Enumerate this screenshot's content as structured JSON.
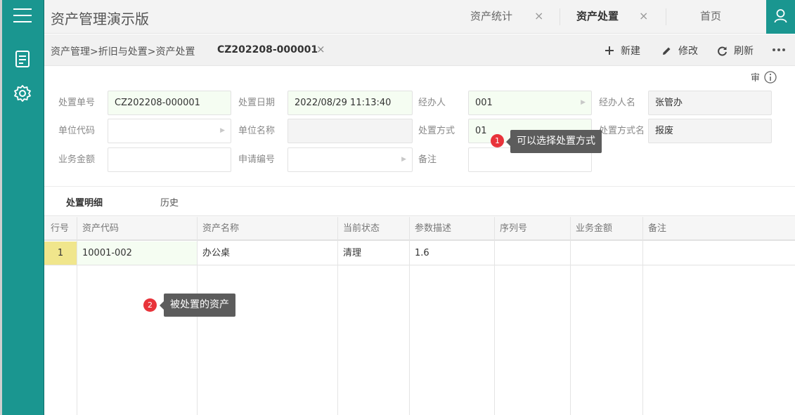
{
  "app": {
    "title": "资产管理演示版"
  },
  "tabs": [
    {
      "label": "资产统计",
      "close": "×"
    },
    {
      "label": "资产处置",
      "close": "×"
    },
    {
      "label": "首页"
    }
  ],
  "breadcrumb": {
    "path": "资产管理>折旧与处置>资产处置",
    "doc_id": "CZ202208-000001",
    "close": "×"
  },
  "toolbar": {
    "new_label": "新建",
    "edit_label": "修改",
    "refresh_label": "刷新"
  },
  "audit": {
    "label": "审"
  },
  "form": {
    "doc_no": {
      "label": "处置单号",
      "value": "CZ202208-000001"
    },
    "date": {
      "label": "处置日期",
      "value": "2022/08/29 11:13:40"
    },
    "handler": {
      "label": "经办人",
      "value": "001"
    },
    "handler_name": {
      "label": "经办人名",
      "value": "张管办"
    },
    "unit_code": {
      "label": "单位代码",
      "value": ""
    },
    "unit_name": {
      "label": "单位名称",
      "value": ""
    },
    "method": {
      "label": "处置方式",
      "value": "01"
    },
    "method_name": {
      "label": "处置方式名",
      "value": "报废"
    },
    "amount": {
      "label": "业务金额",
      "value": ""
    },
    "apply_no": {
      "label": "申请编号",
      "value": ""
    },
    "remark": {
      "label": "备注",
      "value": ""
    }
  },
  "tooltips": [
    {
      "num": "1",
      "text": "可以选择处置方式"
    },
    {
      "num": "2",
      "text": "被处置的资产"
    }
  ],
  "sub_tabs": [
    "处置明细",
    "历史"
  ],
  "table": {
    "columns": [
      "行号",
      "资产代码",
      "资产名称",
      "当前状态",
      "参数描述",
      "序列号",
      "业务金额",
      "备注"
    ],
    "rows": [
      {
        "rownum": "1",
        "code": "10001-002",
        "name": "办公桌",
        "status": "清理",
        "param": "1.6",
        "serial": "",
        "amount": "",
        "remark": ""
      }
    ]
  },
  "colors": {
    "accent": "#1a9690",
    "tooltip_bg": "#5c5c5c",
    "badge": "#e8333a",
    "row_highlight": "#f0e68c"
  }
}
